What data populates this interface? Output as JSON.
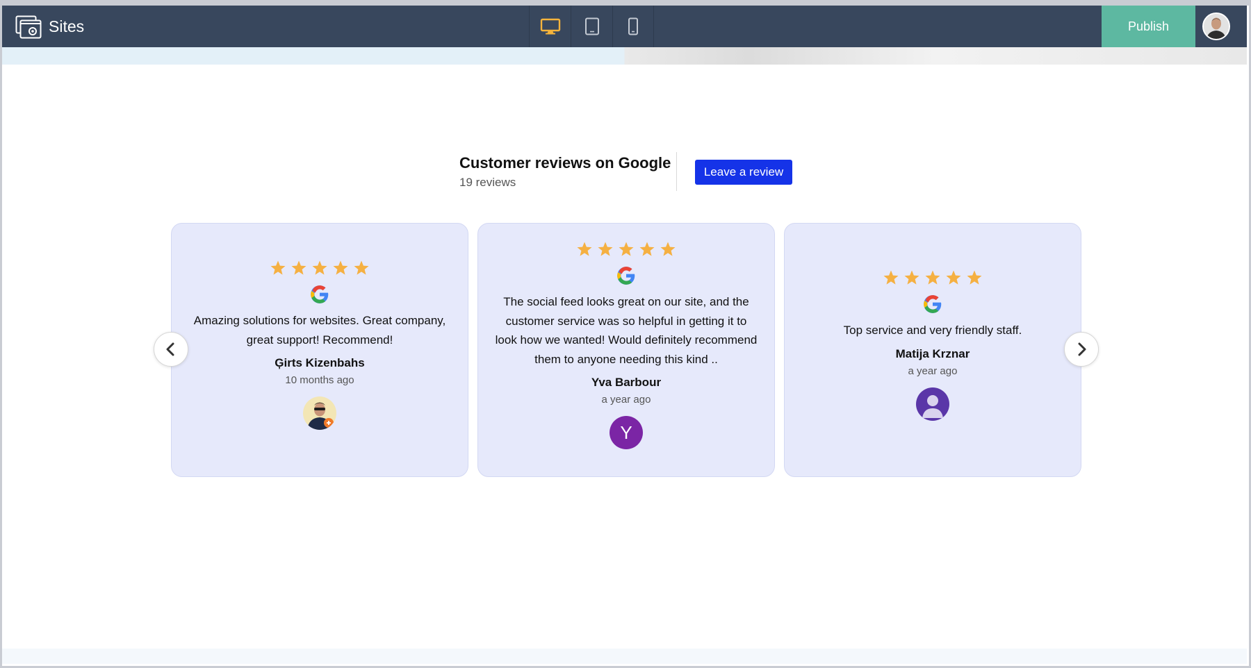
{
  "app": {
    "title": "Sites",
    "publish_label": "Publish"
  },
  "devices": [
    {
      "name": "desktop",
      "active": true
    },
    {
      "name": "tablet",
      "active": false
    },
    {
      "name": "mobile",
      "active": false
    }
  ],
  "colors": {
    "topbar": "#38475d",
    "publish": "#5db8a1",
    "active_device": "#f5b43c",
    "star": "#f5b042",
    "button": "#1533e8",
    "card": "#e6e9fb"
  },
  "widget": {
    "title": "Customer reviews on Google",
    "count": "19 reviews",
    "leave_review_label": "Leave a review"
  },
  "reviews": [
    {
      "rating": 5,
      "text": "Amazing solutions for websites. Great company, great support! Recommend!",
      "author": "Ģirts Kizenbahs",
      "time": "10 months ago",
      "avatar": "photo"
    },
    {
      "rating": 5,
      "text": "The social feed looks great on our site, and the customer service was so helpful in getting it to look how we wanted! Would definitely recommend them to anyone needing this kind ..",
      "author": "Yva Barbour",
      "time": "a year ago",
      "avatar": "Y"
    },
    {
      "rating": 5,
      "text": "Top service and very friendly staff.",
      "author": "Matija Krznar",
      "time": "a year ago",
      "avatar": "person-icon"
    }
  ]
}
